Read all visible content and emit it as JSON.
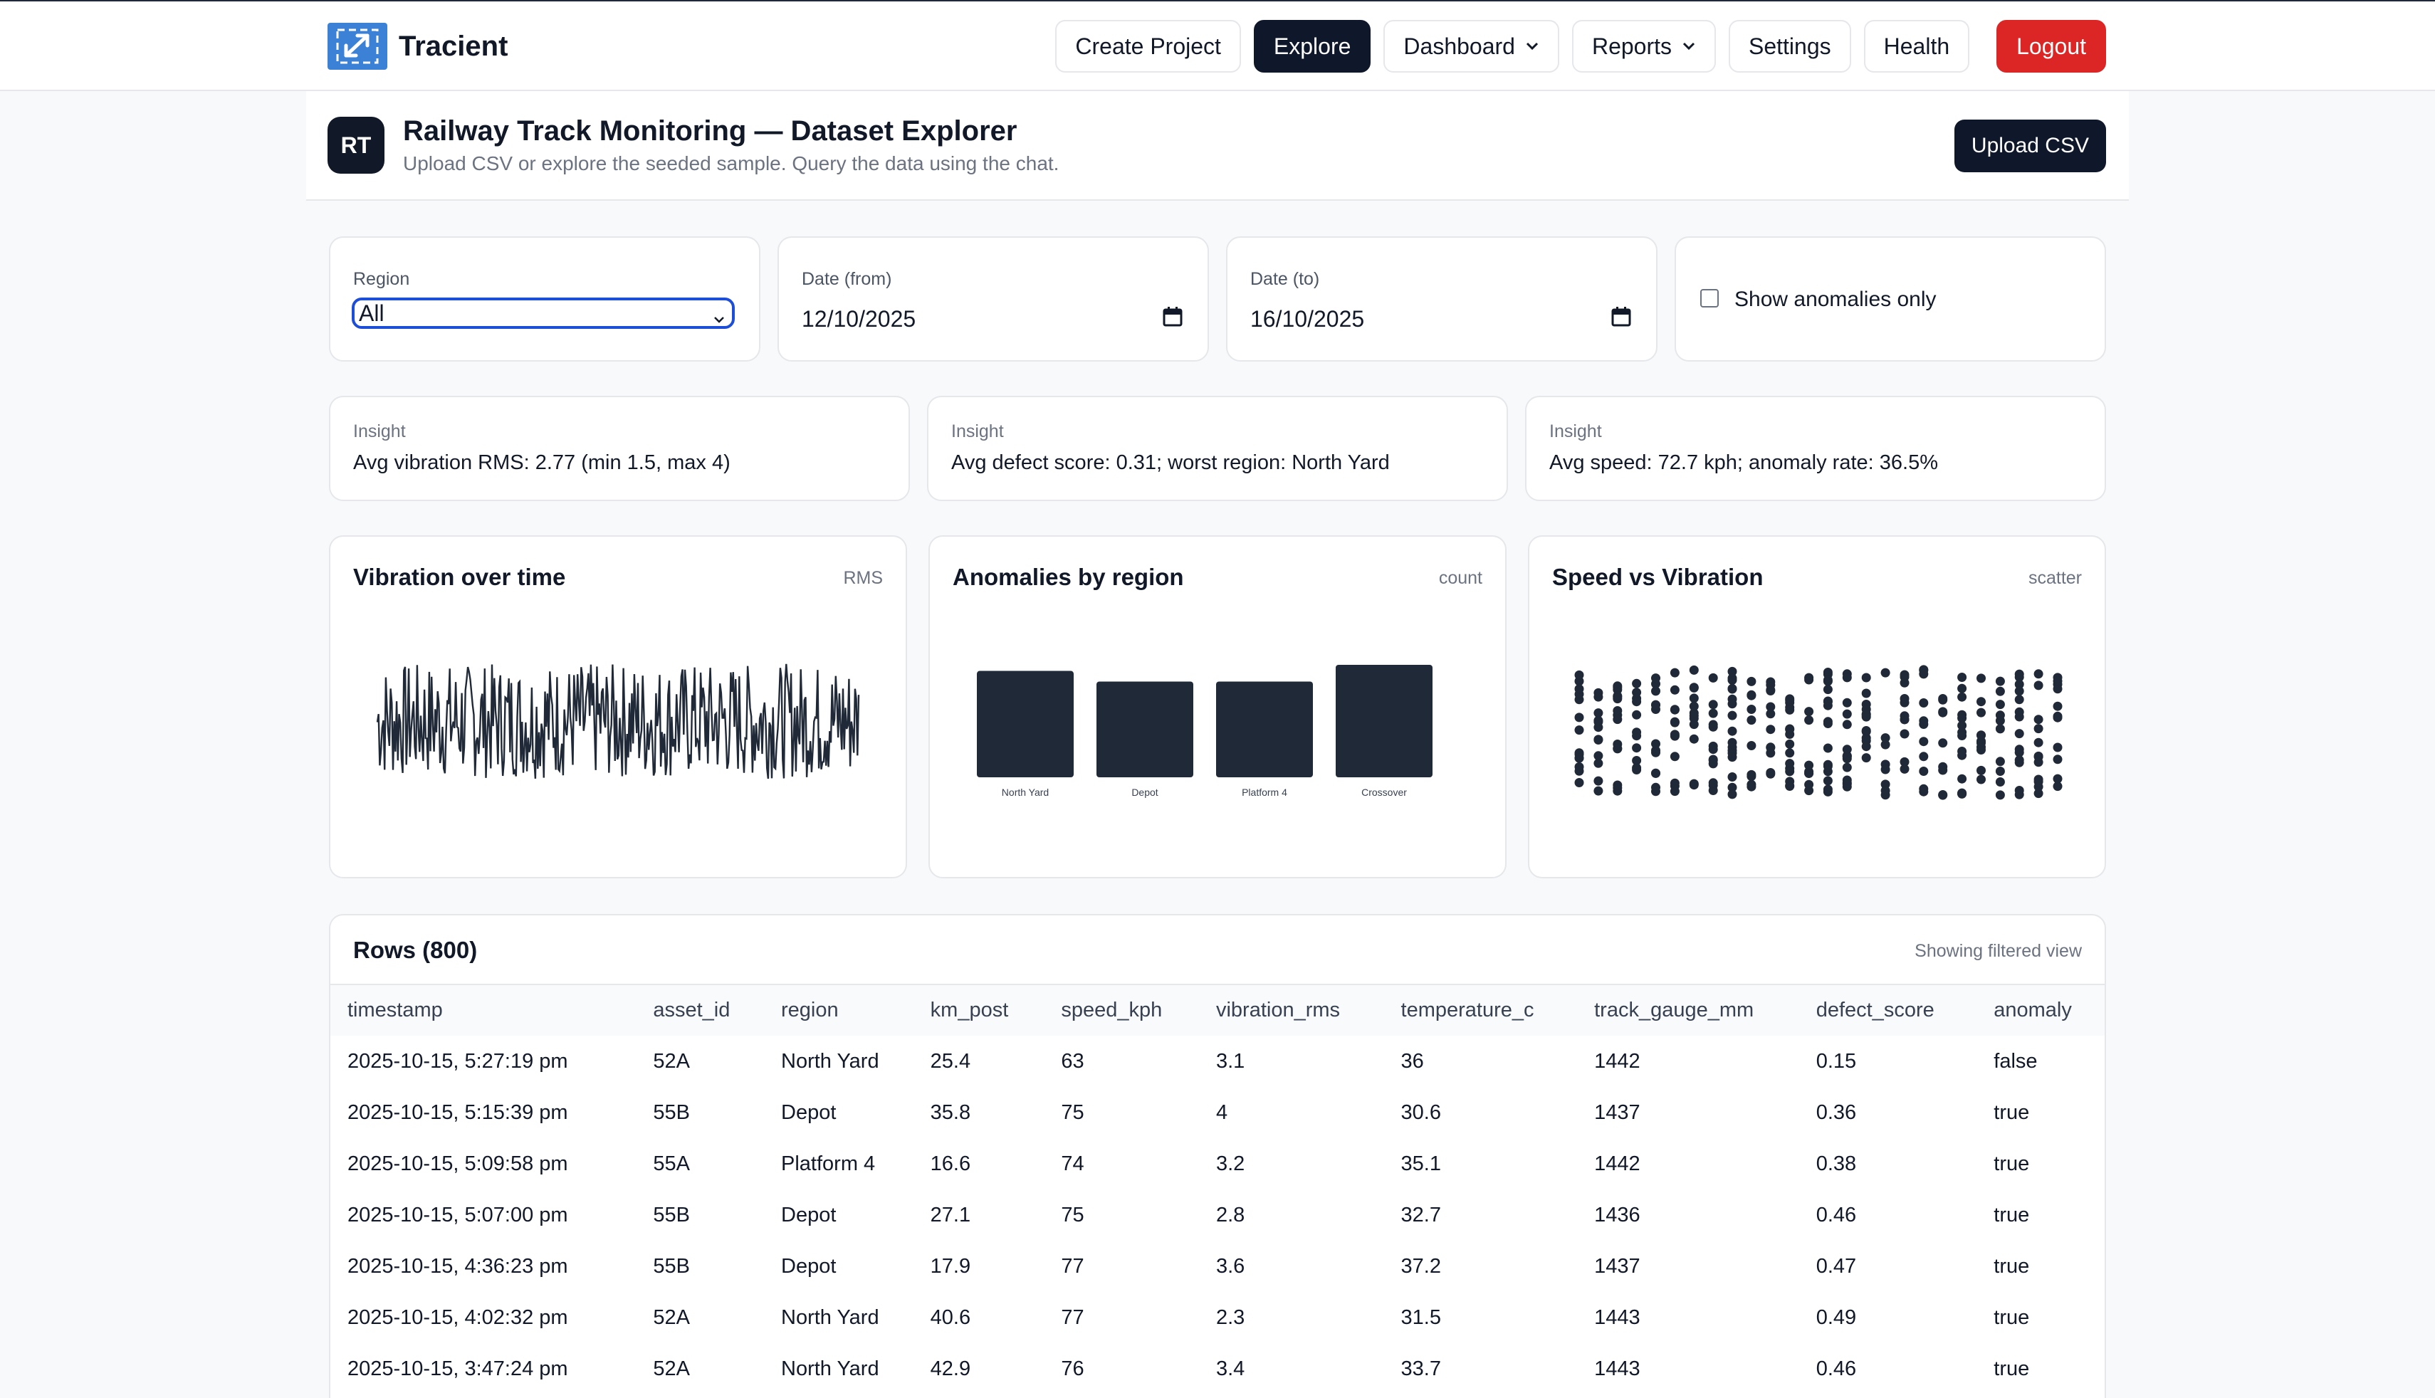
{
  "app": {
    "name": "Tracient",
    "brand_color": "#3b82d6"
  },
  "nav": {
    "create_project": "Create Project",
    "explore": "Explore",
    "dashboard": "Dashboard",
    "reports": "Reports",
    "settings": "Settings",
    "health": "Health",
    "logout": "Logout",
    "active": "Explore"
  },
  "header": {
    "avatar_initials": "RT",
    "title": "Railway Track Monitoring — Dataset Explorer",
    "subtitle": "Upload CSV or explore the seeded sample. Query the data using the chat.",
    "upload_label": "Upload CSV"
  },
  "filters": {
    "region_label": "Region",
    "region_value": "All",
    "date_from_label": "Date (from)",
    "date_from_value": "12/10/2025",
    "date_to_label": "Date (to)",
    "date_to_value": "16/10/2025",
    "anomalies_label": "Show anomalies only",
    "anomalies_checked": false
  },
  "insights": [
    {
      "label": "Insight",
      "text": "Avg vibration RMS: 2.77 (min 1.5, max 4)"
    },
    {
      "label": "Insight",
      "text": "Avg defect score: 0.31; worst region: North Yard"
    },
    {
      "label": "Insight",
      "text": "Avg speed: 72.7 kph; anomaly rate: 36.5%"
    }
  ],
  "charts": {
    "vibration": {
      "title": "Vibration over time",
      "unit": "RMS"
    },
    "anomalies": {
      "title": "Anomalies by region",
      "unit": "count"
    },
    "scatter": {
      "title": "Speed vs Vibration",
      "unit": "scatter"
    }
  },
  "chart_data": [
    {
      "type": "line",
      "title": "Vibration over time",
      "ylabel": "RMS",
      "ylim": [
        1.5,
        4
      ],
      "description_values": "dense noisy series of vibration RMS readings"
    },
    {
      "type": "bar",
      "title": "Anomalies by region",
      "ylabel": "count",
      "categories": [
        "North Yard",
        "Depot",
        "Platform 4",
        "Crossover"
      ],
      "values": [
        70,
        63,
        63,
        74
      ]
    },
    {
      "type": "scatter",
      "title": "Speed vs Vibration",
      "xlim": [
        60,
        85
      ],
      "ylim": [
        1.5,
        4
      ]
    }
  ],
  "table": {
    "title": "Rows (800)",
    "note": "Showing filtered view",
    "columns": [
      "timestamp",
      "asset_id",
      "region",
      "km_post",
      "speed_kph",
      "vibration_rms",
      "temperature_c",
      "track_gauge_mm",
      "defect_score",
      "anomaly"
    ],
    "rows": [
      [
        "2025-10-15, 5:27:19 pm",
        "52A",
        "North Yard",
        "25.4",
        "63",
        "3.1",
        "36",
        "1442",
        "0.15",
        "false"
      ],
      [
        "2025-10-15, 5:15:39 pm",
        "55B",
        "Depot",
        "35.8",
        "75",
        "4",
        "30.6",
        "1437",
        "0.36",
        "true"
      ],
      [
        "2025-10-15, 5:09:58 pm",
        "55A",
        "Platform 4",
        "16.6",
        "74",
        "3.2",
        "35.1",
        "1442",
        "0.38",
        "true"
      ],
      [
        "2025-10-15, 5:07:00 pm",
        "55B",
        "Depot",
        "27.1",
        "75",
        "2.8",
        "32.7",
        "1436",
        "0.46",
        "true"
      ],
      [
        "2025-10-15, 4:36:23 pm",
        "55B",
        "Depot",
        "17.9",
        "77",
        "3.6",
        "37.2",
        "1437",
        "0.47",
        "true"
      ],
      [
        "2025-10-15, 4:02:32 pm",
        "52A",
        "North Yard",
        "40.6",
        "77",
        "2.3",
        "31.5",
        "1443",
        "0.49",
        "true"
      ],
      [
        "2025-10-15, 3:47:24 pm",
        "52A",
        "North Yard",
        "42.9",
        "76",
        "3.4",
        "33.7",
        "1443",
        "0.46",
        "true"
      ]
    ]
  }
}
